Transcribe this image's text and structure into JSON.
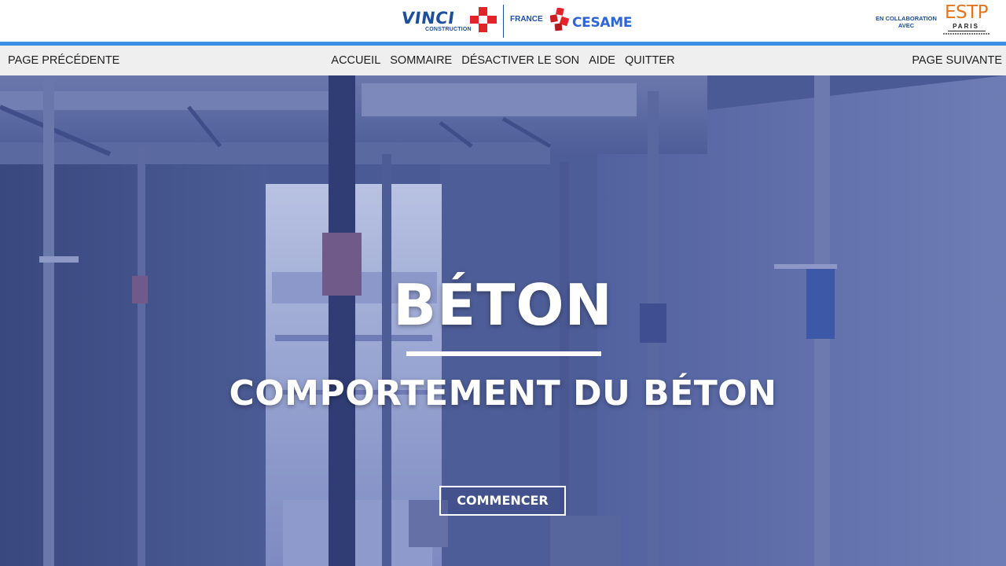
{
  "header": {
    "vinci": {
      "name": "VINCI",
      "sub": "CONSTRUCTION"
    },
    "france": "FRANCE",
    "cesame": "CESAME",
    "collab": {
      "line1": "EN COLLABORATION",
      "line2": "AVEC"
    },
    "estp": {
      "name": "ESTP",
      "city": "PARIS"
    }
  },
  "nav": {
    "prev": "PAGE PRÉCÉDENTE",
    "next": "PAGE SUIVANTE",
    "items": [
      "ACCUEIL",
      "SOMMAIRE",
      "DÉSACTIVER LE SON",
      "AIDE",
      "QUITTER"
    ]
  },
  "hero": {
    "title": "BÉTON",
    "subtitle": "COMPORTEMENT DU BÉTON",
    "button": "COMMENCER"
  },
  "colors": {
    "accent_bar": "#3d8fe6",
    "vinci_blue": "#1d4f9c",
    "vinci_red": "#e2242a",
    "cesame_blue": "#2d64d8",
    "estp_orange": "#e2761e",
    "hero_overlay": "#3b4c8c"
  },
  "icons": [
    "vinci-cross-logo",
    "cesame-logo",
    "estp-logo"
  ]
}
